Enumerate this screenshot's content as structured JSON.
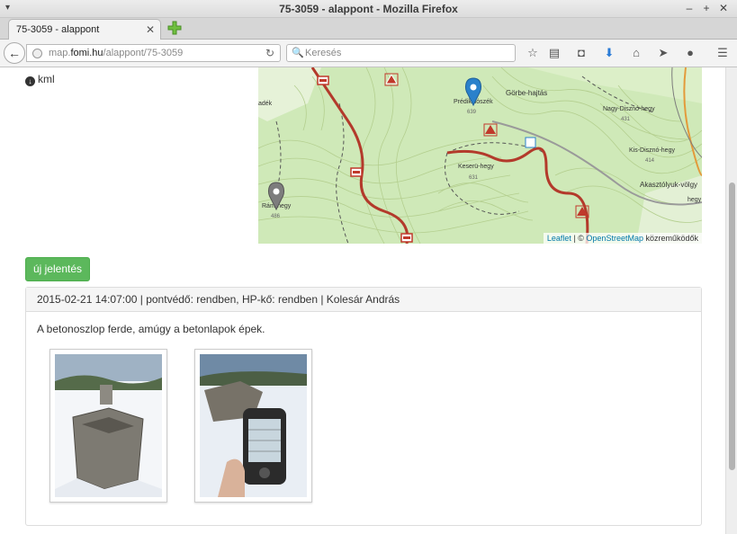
{
  "window": {
    "title": "75-3059 - alappont - Mozilla Firefox"
  },
  "tab": {
    "label": "75-3059 - alappont"
  },
  "nav": {
    "url_prefix": "map.",
    "url_host": "fomi.hu",
    "url_path": "/alappont/75-3059",
    "search_placeholder": "Keresés"
  },
  "page": {
    "kml_link": "kml",
    "new_report_button": "új jelentés",
    "report": {
      "header": "2015-02-21 14:07:00 | pontvédő: rendben, HP-kő: rendben | Kolesár András",
      "text": "A betonoszlop ferde, amúgy a betonlapok épek."
    }
  },
  "map": {
    "labels": {
      "predikaloszek": "Prédikálószék",
      "predikaloszek_elev": "639",
      "gorbe": "Görbe-hajtás",
      "nagydiszno": "Nagy-Disznó-hegy",
      "nagydiszno_elev": "431",
      "kisdiszno": "Kis-Disznó-hegy",
      "kisdiszno_elev": "414",
      "keseru": "Keserü-hegy",
      "keseru_elev": "631",
      "akasztolyuk": "Akasztólyuk-völgy",
      "ramhegy": "Rám-hegy",
      "ramhegy_elev": "486",
      "adek": "adék",
      "hegy_edge": "hegy"
    },
    "attribution": {
      "leaflet": "Leaflet",
      "sep": " | © ",
      "osm": "OpenStreetMap",
      "contrib": " közreműködők"
    }
  },
  "colors": {
    "button_green": "#5cb85c",
    "marker_blue": "#2a81cb",
    "trail_red": "#b33a2b",
    "map_green": "#cfe9b8"
  }
}
